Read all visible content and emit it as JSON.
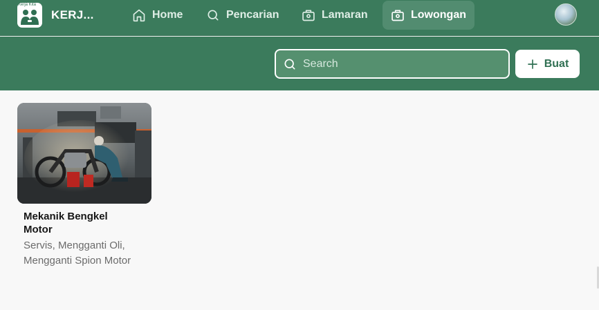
{
  "header": {
    "logo_text": "Kerja Kita",
    "brand": "KERJ...",
    "nav": [
      {
        "label": "Home",
        "icon": "home-icon"
      },
      {
        "label": "Pencarian",
        "icon": "search-icon"
      },
      {
        "label": "Lamaran",
        "icon": "briefcase-icon"
      },
      {
        "label": "Lowongan",
        "icon": "briefcase-icon",
        "active": true
      }
    ]
  },
  "toolbar": {
    "search_placeholder": "Search",
    "create_label": "Buat"
  },
  "jobs": [
    {
      "title": "Mekanik Bengkel Motor",
      "description": "Servis, Mengganti Oli, Mengganti Spion Motor",
      "image": "mechanic-repairing-motorcycle-photo"
    }
  ],
  "colors": {
    "primary": "#3b7b5c",
    "active_nav": "#528c70",
    "background": "#f8f8f8",
    "description_text": "#6b6b6b"
  }
}
